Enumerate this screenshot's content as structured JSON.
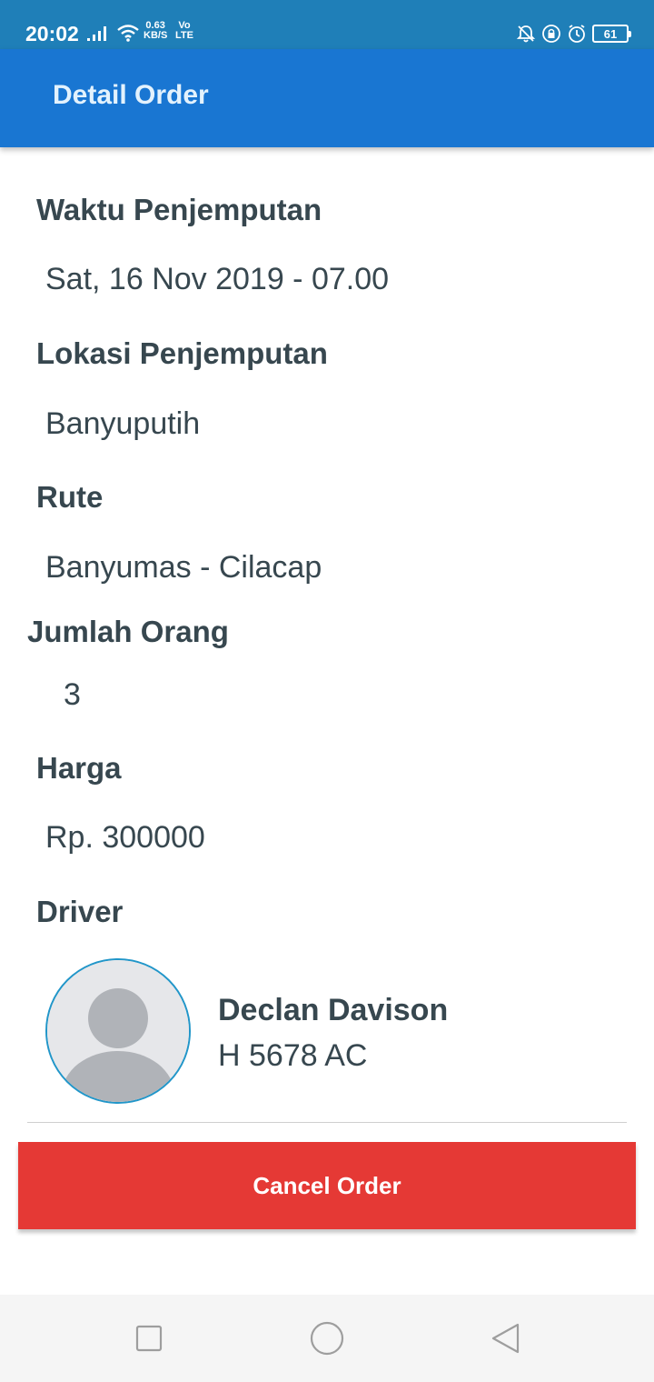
{
  "status_bar": {
    "time": "20:02",
    "net_speed_top": "0.63",
    "net_speed_bottom": "KB/S",
    "net_type_top": "Vo",
    "net_type_bottom": "LTE",
    "battery": "61",
    "icons": [
      "signal-icon",
      "wifi-icon",
      "bell-muted-icon",
      "rotation-lock-icon",
      "alarm-icon",
      "battery-icon"
    ]
  },
  "app_bar": {
    "title": "Detail Order"
  },
  "order": {
    "pickup_time_label": "Waktu Penjemputan",
    "pickup_time_value": "Sat, 16 Nov 2019 - 07.00",
    "pickup_location_label": "Lokasi Penjemputan",
    "pickup_location_value": "Banyuputih",
    "route_label": "Rute",
    "route_value": "Banyumas - Cilacap",
    "people_label": "Jumlah Orang",
    "people_value": "3",
    "price_label": "Harga",
    "price_value": "Rp. 300000",
    "driver_label": "Driver"
  },
  "driver": {
    "name": "Declan Davison",
    "plate": "H 5678 AC",
    "avatar_icon": "person-avatar-icon"
  },
  "actions": {
    "cancel_label": "Cancel Order"
  },
  "colors": {
    "status_bar": "#1f7fb8",
    "app_bar": "#1976d2",
    "cancel_button": "#e53935",
    "text": "#37474f"
  },
  "nav_bar": {
    "icons": [
      "recents-icon",
      "home-icon",
      "back-icon"
    ]
  }
}
